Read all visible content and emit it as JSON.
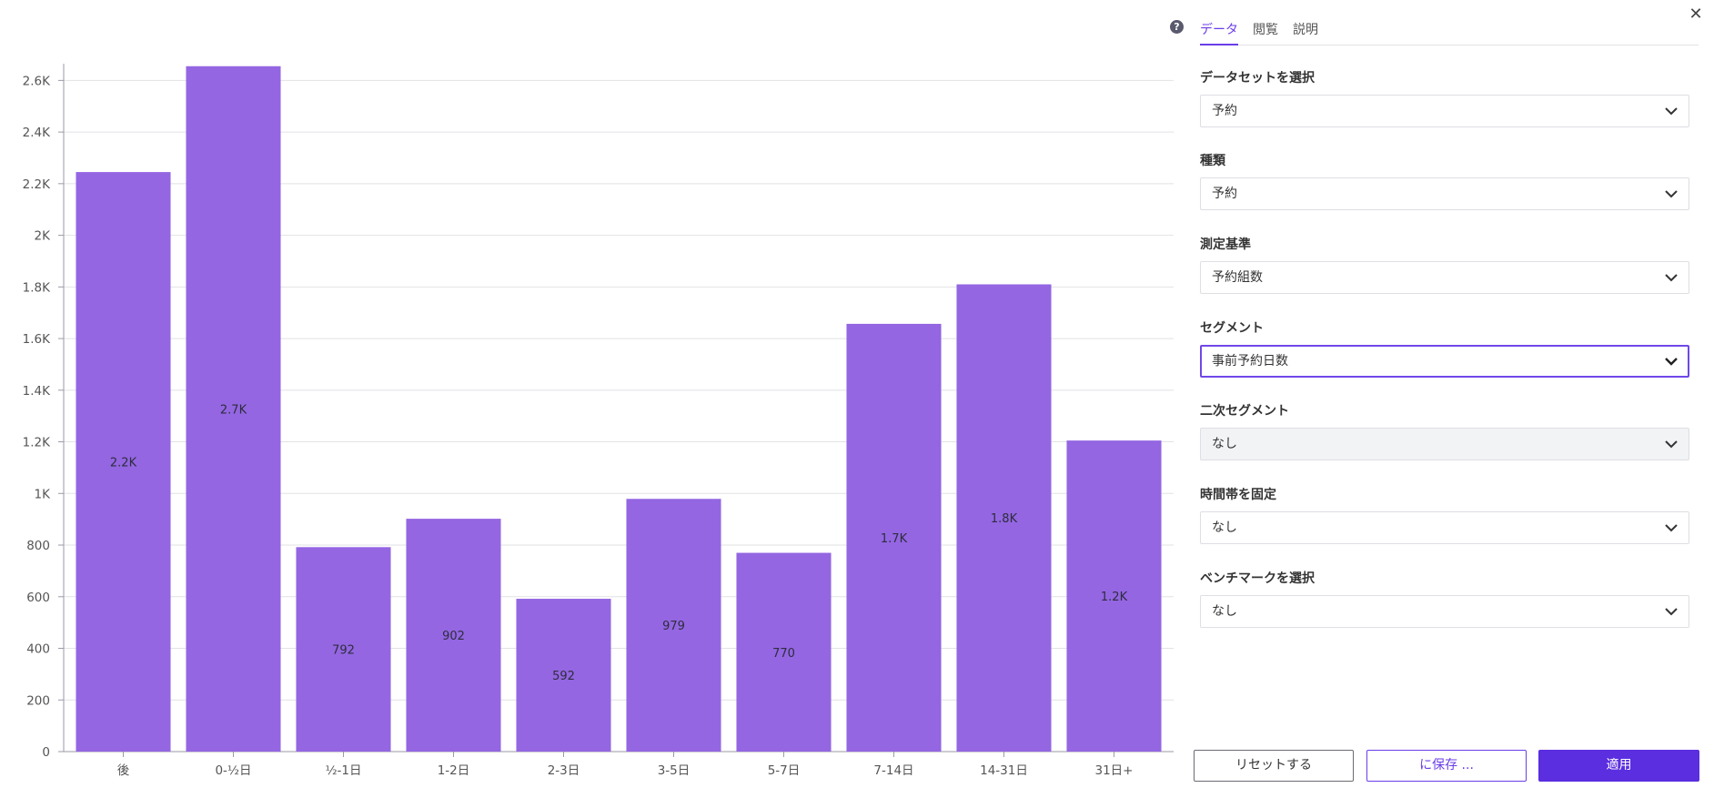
{
  "chart_data": {
    "type": "bar",
    "categories": [
      "後",
      "0-½日",
      "½-1日",
      "1-2日",
      "2-3日",
      "3-5日",
      "5-7日",
      "7-14日",
      "14-31日",
      "31日+"
    ],
    "values": [
      2245,
      2655,
      792,
      902,
      592,
      979,
      770,
      1657,
      1810,
      1205
    ],
    "data_labels": [
      "2.2K",
      "2.7K",
      "792",
      "902",
      "592",
      "979",
      "770",
      "1.7K",
      "1.8K",
      "1.2K"
    ],
    "y_ticks": [
      0,
      200,
      400,
      600,
      800,
      1000,
      1200,
      1400,
      1600,
      1800,
      2000,
      2200,
      2400,
      2600
    ],
    "y_tick_labels": [
      "0",
      "200",
      "400",
      "600",
      "800",
      "1K",
      "1.2K",
      "1.4K",
      "1.6K",
      "1.8K",
      "2K",
      "2.2K",
      "2.4K",
      "2.6K"
    ],
    "ylim": [
      0,
      2700
    ],
    "grid": true,
    "bar_color": "#9466e2",
    "title": "",
    "xlabel": "",
    "ylabel": ""
  },
  "panel": {
    "help_icon": "question-icon",
    "close_icon": "close-icon",
    "tabs": [
      {
        "label": "データ",
        "active": true
      },
      {
        "label": "閲覧",
        "active": false
      },
      {
        "label": "説明",
        "active": false
      }
    ],
    "fields": [
      {
        "label": "データセットを選択",
        "value": "予約",
        "state": "normal"
      },
      {
        "label": "種類",
        "value": "予約",
        "state": "normal"
      },
      {
        "label": "測定基準",
        "value": "予約組数",
        "state": "normal"
      },
      {
        "label": "セグメント",
        "value": "事前予約日数",
        "state": "focused"
      },
      {
        "label": "二次セグメント",
        "value": "なし",
        "state": "disabled"
      },
      {
        "label": "時間帯を固定",
        "value": "なし",
        "state": "normal"
      },
      {
        "label": "ベンチマークを選択",
        "value": "なし",
        "state": "normal"
      }
    ],
    "buttons": {
      "reset": "リセットする",
      "save": "に保存 ...",
      "apply": "適用"
    }
  },
  "colors": {
    "accent": "#6a3de8",
    "apply_button": "#5b2ee0",
    "bar": "#9466e2"
  }
}
